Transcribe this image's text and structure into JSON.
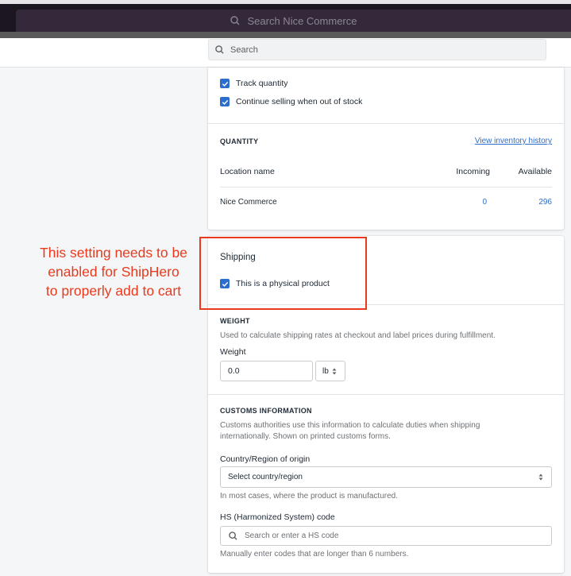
{
  "topbar": {
    "search_placeholder": "Search Nice Commerce"
  },
  "app_search": {
    "placeholder": "Search"
  },
  "inventory": {
    "track_quantity": "Track quantity",
    "continue_selling": "Continue selling when out of stock",
    "quantity_heading": "QUANTITY",
    "view_history": "View inventory history",
    "columns": [
      "Location name",
      "Incoming",
      "Available"
    ],
    "rows": [
      {
        "location": "Nice Commerce",
        "incoming": "0",
        "available": "296"
      }
    ]
  },
  "shipping": {
    "title": "Shipping",
    "physical_product": "This is a physical product",
    "weight_heading": "WEIGHT",
    "weight_help": "Used to calculate shipping rates at checkout and label prices during fulfillment.",
    "weight_label": "Weight",
    "weight_value": "0.0",
    "weight_unit": "lb",
    "customs_heading": "CUSTOMS INFORMATION",
    "customs_help": "Customs authorities use this information to calculate duties when shipping internationally. Shown on printed customs forms.",
    "origin_label": "Country/Region of origin",
    "origin_selected": "Select country/region",
    "origin_help": "In most cases, where the product is manufactured.",
    "hs_label": "HS (Harmonized System) code",
    "hs_placeholder": "Search or enter a HS code",
    "hs_help": "Manually enter codes that are longer than 6 numbers."
  },
  "annotation": {
    "line1": "This setting needs to be",
    "line2": "enabled for ShipHero",
    "line3": "to properly add to cart"
  },
  "colors": {
    "accent": "#2c6ecb",
    "annotation": "#ea3a1d"
  }
}
